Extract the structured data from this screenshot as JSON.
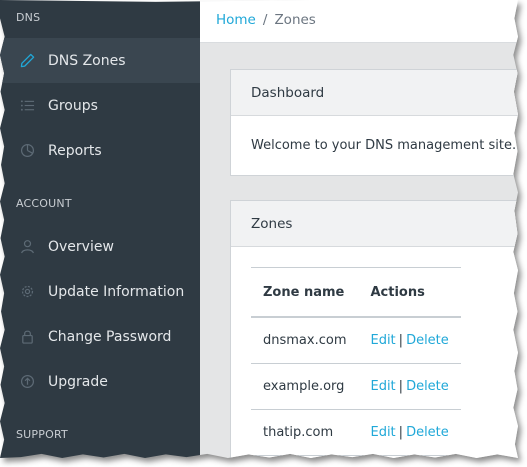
{
  "sidebar": {
    "sections": [
      {
        "heading": "DNS",
        "items": [
          {
            "label": "DNS Zones",
            "icon": "pencil-icon",
            "active": true
          },
          {
            "label": "Groups",
            "icon": "list-icon"
          },
          {
            "label": "Reports",
            "icon": "pie-chart-icon"
          }
        ]
      },
      {
        "heading": "ACCOUNT",
        "items": [
          {
            "label": "Overview",
            "icon": "user-icon"
          },
          {
            "label": "Update Information",
            "icon": "gear-icon"
          },
          {
            "label": "Change Password",
            "icon": "lock-icon"
          },
          {
            "label": "Upgrade",
            "icon": "arrow-up-circle-icon"
          }
        ]
      },
      {
        "heading": "SUPPORT",
        "items": []
      }
    ]
  },
  "breadcrumb": {
    "home": "Home",
    "separator": "/",
    "current": "Zones"
  },
  "dashboard_card": {
    "title": "Dashboard",
    "text": "Welcome to your DNS management site. Fi"
  },
  "zones_card": {
    "title": "Zones",
    "columns": [
      "Zone name",
      "Actions"
    ],
    "rows": [
      {
        "zone": "dnsmax.com",
        "edit": "Edit",
        "sep": "|",
        "delete": "Delete"
      },
      {
        "zone": "example.org",
        "edit": "Edit",
        "sep": "|",
        "delete": "Delete"
      },
      {
        "zone": "thatip.com",
        "edit": "Edit",
        "sep": "|",
        "delete": "Delete"
      }
    ]
  },
  "colors": {
    "sidebar_bg": "#2f3a43",
    "sidebar_active": "#3a4650",
    "link": "#20a8d8",
    "main_bg": "#e4e5e6"
  }
}
